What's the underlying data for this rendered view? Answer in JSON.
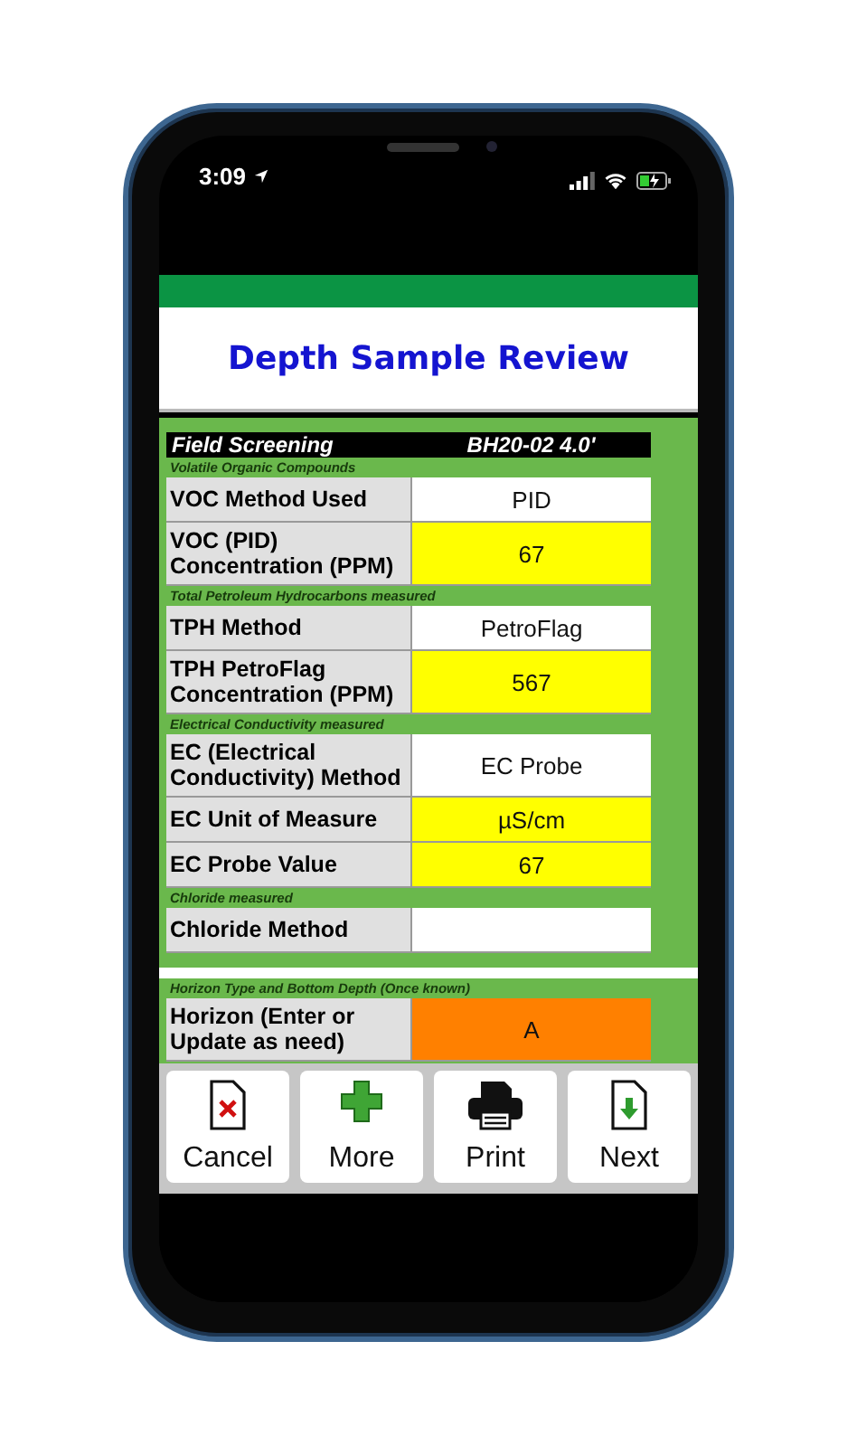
{
  "status_bar": {
    "time": "3:09"
  },
  "title": "Depth Sample Review",
  "sections": [
    {
      "header": {
        "title": "Field Screening",
        "code": "BH20-02 4.0'"
      },
      "rows": [
        {
          "kind": "note",
          "text": "Volatile Organic Compounds"
        },
        {
          "kind": "field",
          "label": "VOC Method Used",
          "value": "PID",
          "color": "#ffffff"
        },
        {
          "kind": "field",
          "label": "VOC (PID) Concentration (PPM)",
          "value": "67",
          "color": "#ffff00"
        },
        {
          "kind": "note",
          "text": "Total Petroleum Hydrocarbons measured"
        },
        {
          "kind": "field",
          "label": "TPH Method",
          "value": "PetroFlag",
          "color": "#ffffff"
        },
        {
          "kind": "field",
          "label": "TPH PetroFlag Concentration (PPM)",
          "value": "567",
          "color": "#ffff00"
        },
        {
          "kind": "note",
          "text": "Electrical Conductivity measured"
        },
        {
          "kind": "field",
          "label": "EC (Electrical Conductivity) Method",
          "value": "EC Probe",
          "color": "#ffffff"
        },
        {
          "kind": "field",
          "label": "EC Unit of Measure",
          "value": "µS/cm",
          "color": "#ffff00"
        },
        {
          "kind": "field",
          "label": "EC Probe Value",
          "value": "67",
          "color": "#ffff00"
        },
        {
          "kind": "note",
          "text": "Chloride measured"
        },
        {
          "kind": "field",
          "label": "Chloride Method",
          "color": "#ffffff"
        }
      ]
    },
    {
      "rows": [
        {
          "kind": "note",
          "text": "Horizon Type and Bottom Depth (Once known)"
        },
        {
          "kind": "field",
          "label": "Horizon (Enter or Update as need)",
          "value": "A",
          "color": "#ff8000"
        }
      ]
    }
  ],
  "buttons": [
    {
      "kind": "cancel",
      "label": "Cancel"
    },
    {
      "kind": "more",
      "label": "More"
    },
    {
      "kind": "print",
      "label": "Print"
    },
    {
      "kind": "next",
      "label": "Next"
    }
  ]
}
